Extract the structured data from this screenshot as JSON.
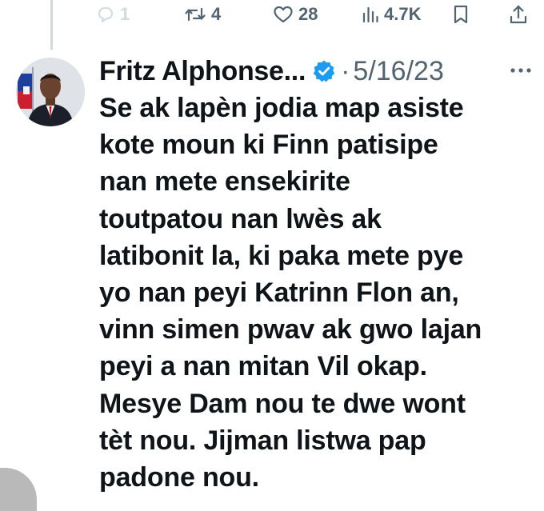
{
  "action_bar": {
    "reply_count": "1",
    "retweet_count": "4",
    "like_count": "28",
    "view_count": "4.7K",
    "icons": {
      "reply": "comment-bubble-icon",
      "retweet": "retweet-icon",
      "like": "heart-icon",
      "views": "bar-chart-icon",
      "bookmark": "bookmark-icon",
      "share": "share-upload-icon"
    }
  },
  "post": {
    "author_name": "Fritz Alphonse...",
    "verified": true,
    "separator": "·",
    "date": "5/16/23",
    "text_lines": [
      "Se ak lapèn jodia map asiste",
      "kote moun ki Finn patisipe",
      "nan mete ensekirite",
      "toutpatou nan lwès ak",
      "latibonit la, ki paka mete pye",
      "yo nan peyi Katrinn Flon an,",
      "vinn simen pwav ak gwo lajan",
      "peyi a nan mitan Vil okap.",
      "Mesye Dam nou te dwe wont",
      "tèt nou. Jijman listwa pap",
      "padone nou."
    ]
  },
  "colors": {
    "text_primary": "#0f1419",
    "text_secondary": "#536471",
    "verified_blue": "#1d9bf0",
    "thread_line": "#cfd9de"
  }
}
